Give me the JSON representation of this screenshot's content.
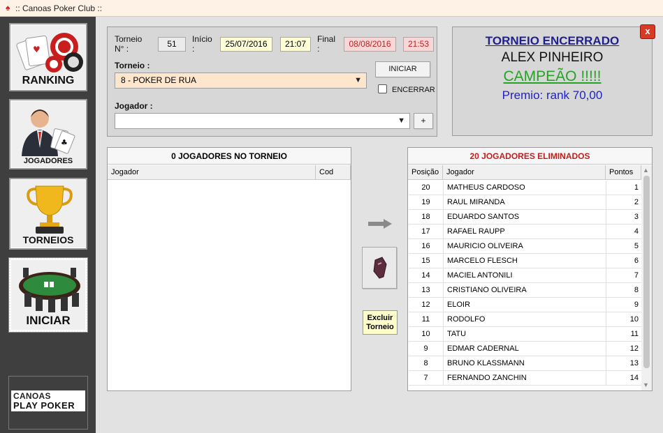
{
  "window": {
    "title": ":: Canoas Poker Club ::"
  },
  "sidebar": {
    "items": [
      {
        "label": "RANKING"
      },
      {
        "label": "JOGADORES"
      },
      {
        "label": "TORNEIOS"
      },
      {
        "label": "INICIAR"
      }
    ],
    "brand": {
      "line1": "CANOAS",
      "line2": "PLAY POKER"
    }
  },
  "form": {
    "torneio_no_label": "Torneio N° :",
    "torneio_no": "51",
    "inicio_label": "Início :",
    "inicio_date": "25/07/2016",
    "inicio_time": "21:07",
    "final_label": "Final :",
    "final_date": "08/08/2016",
    "final_time": "21:53",
    "torneio_label": "Torneio :",
    "torneio_selected": "8 - POKER DE RUA",
    "iniciar_button": "INICIAR",
    "encerrar_label": "ENCERRAR",
    "jogador_label": "Jogador :",
    "jogador_selected": "",
    "add_button": "+"
  },
  "status": {
    "title": "TORNEIO ENCERRADO",
    "winner": "ALEX PINHEIRO",
    "champion": "CAMPEÃO !!!!!",
    "prize": "Premio: rank 70,00",
    "close": "x"
  },
  "in_tournament": {
    "title": "0 JOGADORES NO TORNEIO",
    "columns": [
      "Jogador",
      "Cod"
    ]
  },
  "eliminated": {
    "title": "20 JOGADORES ELIMINADOS",
    "columns": [
      "Posição",
      "Jogador",
      "Pontos"
    ],
    "rows": [
      {
        "pos": "20",
        "name": "MATHEUS CARDOSO",
        "pts": "1"
      },
      {
        "pos": "19",
        "name": "RAUL MIRANDA",
        "pts": "2"
      },
      {
        "pos": "18",
        "name": "EDUARDO SANTOS",
        "pts": "3"
      },
      {
        "pos": "17",
        "name": "RAFAEL RAUPP",
        "pts": "4"
      },
      {
        "pos": "16",
        "name": "MAURICIO OLIVEIRA",
        "pts": "5"
      },
      {
        "pos": "15",
        "name": "MARCELO FLESCH",
        "pts": "6"
      },
      {
        "pos": "14",
        "name": "MACIEL ANTONILI",
        "pts": "7"
      },
      {
        "pos": "13",
        "name": "CRISTIANO OLIVEIRA",
        "pts": "8"
      },
      {
        "pos": "12",
        "name": "ELOIR",
        "pts": "9"
      },
      {
        "pos": "11",
        "name": "RODOLFO",
        "pts": "10"
      },
      {
        "pos": "10",
        "name": "TATU",
        "pts": "11"
      },
      {
        "pos": "9",
        "name": "EDMAR CADERNAL",
        "pts": "12"
      },
      {
        "pos": "8",
        "name": "BRUNO KLASSMANN",
        "pts": "13"
      },
      {
        "pos": "7",
        "name": "FERNANDO ZANCHIN",
        "pts": "14"
      }
    ]
  },
  "actions": {
    "excluir_line1": "Excluir",
    "excluir_line2": "Torneio"
  },
  "colors": {
    "accent_red": "#c02020",
    "accent_blue": "#2020c8",
    "accent_green": "#25a325"
  }
}
